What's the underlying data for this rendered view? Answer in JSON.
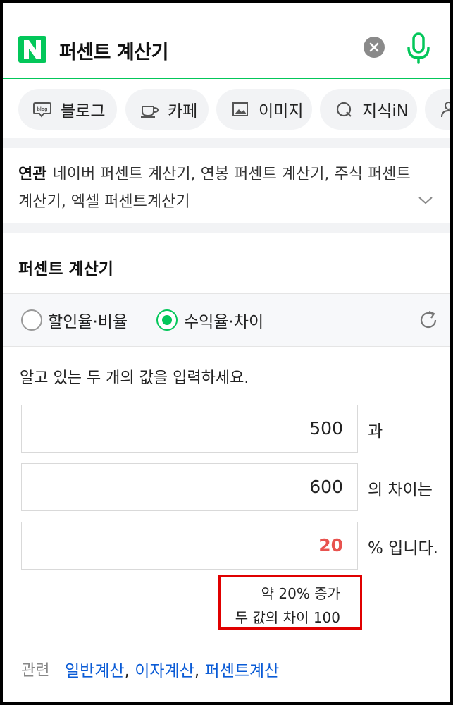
{
  "search": {
    "query": "퍼센트 계산기",
    "logo_letter": "N",
    "brand_color": "#03c75a"
  },
  "categories": [
    {
      "label": "블로그",
      "icon": "blog-icon"
    },
    {
      "label": "카페",
      "icon": "cafe-cup-icon"
    },
    {
      "label": "이미지",
      "icon": "image-icon"
    },
    {
      "label": "지식iN",
      "icon": "kin-icon"
    },
    {
      "label": "",
      "icon": "person-icon"
    }
  ],
  "related": {
    "tag": "연관",
    "text": "네이버 퍼센트 계산기, 연봉 퍼센트 계산기, 주식 퍼센트 계산기, 엑셀 퍼센트계산기"
  },
  "calculator": {
    "title": "퍼센트 계산기",
    "modes": [
      {
        "label": "할인율·비율",
        "selected": false
      },
      {
        "label": "수익율·차이",
        "selected": true
      }
    ],
    "instruction": "알고 있는 두 개의 값을 입력하세요.",
    "value1": "500",
    "suffix1": "과",
    "value2": "600",
    "suffix2": "의 차이는",
    "result": "20",
    "suffix3": "% 입니다.",
    "result_color": "#e8534f",
    "note_line1": "약 20% 증가",
    "note_line2": "두 값의 차이 100"
  },
  "related_calcs": {
    "lead": "관련",
    "items": [
      "일반계산",
      "이자계산",
      "퍼센트계산"
    ],
    "separator": ",",
    "link_color": "#0a5bd6"
  }
}
